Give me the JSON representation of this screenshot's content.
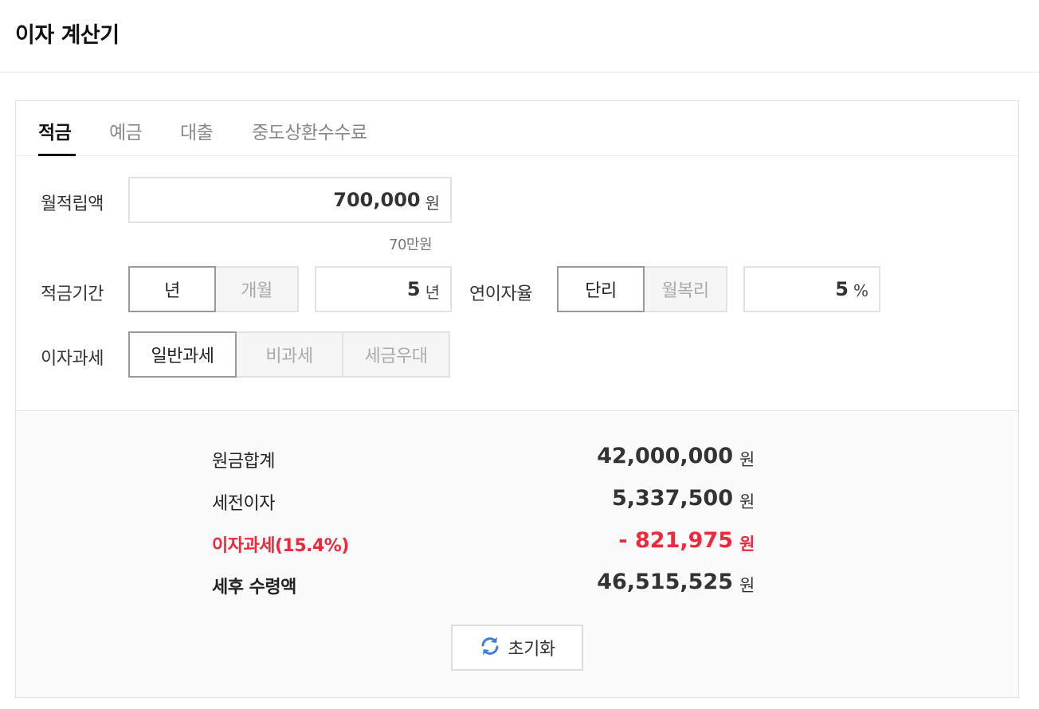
{
  "header": {
    "title": "이자 계산기"
  },
  "tabs": [
    {
      "label": "적금",
      "active": true
    },
    {
      "label": "예금",
      "active": false
    },
    {
      "label": "대출",
      "active": false
    },
    {
      "label": "중도상환수수료",
      "active": false
    }
  ],
  "form": {
    "monthly_deposit": {
      "label": "월적립액",
      "value": "700,000",
      "unit": "원",
      "hint": "70만원"
    },
    "period": {
      "label": "적금기간",
      "options": [
        {
          "label": "년",
          "selected": true
        },
        {
          "label": "개월",
          "selected": false
        }
      ],
      "value": "5",
      "unit": "년"
    },
    "rate": {
      "label": "연이자율",
      "options": [
        {
          "label": "단리",
          "selected": true
        },
        {
          "label": "월복리",
          "selected": false
        }
      ],
      "value": "5",
      "unit": "%"
    },
    "tax": {
      "label": "이자과세",
      "options": [
        {
          "label": "일반과세",
          "selected": true
        },
        {
          "label": "비과세",
          "selected": false
        },
        {
          "label": "세금우대",
          "selected": false
        }
      ]
    }
  },
  "results": [
    {
      "label": "원금합계",
      "value": "42,000,000",
      "unit": "원"
    },
    {
      "label": "세전이자",
      "value": "5,337,500",
      "unit": "원"
    },
    {
      "label": "이자과세(15.4%)",
      "value": "- 821,975",
      "unit": "원",
      "highlight": "#f0283c"
    },
    {
      "label": "세후 수령액",
      "value": "46,515,525",
      "unit": "원"
    }
  ],
  "reset": {
    "label": "초기화",
    "icon": "refresh-icon"
  },
  "colors": {
    "accent_red": "#f0283c",
    "icon_blue": "#3f7fd6"
  }
}
